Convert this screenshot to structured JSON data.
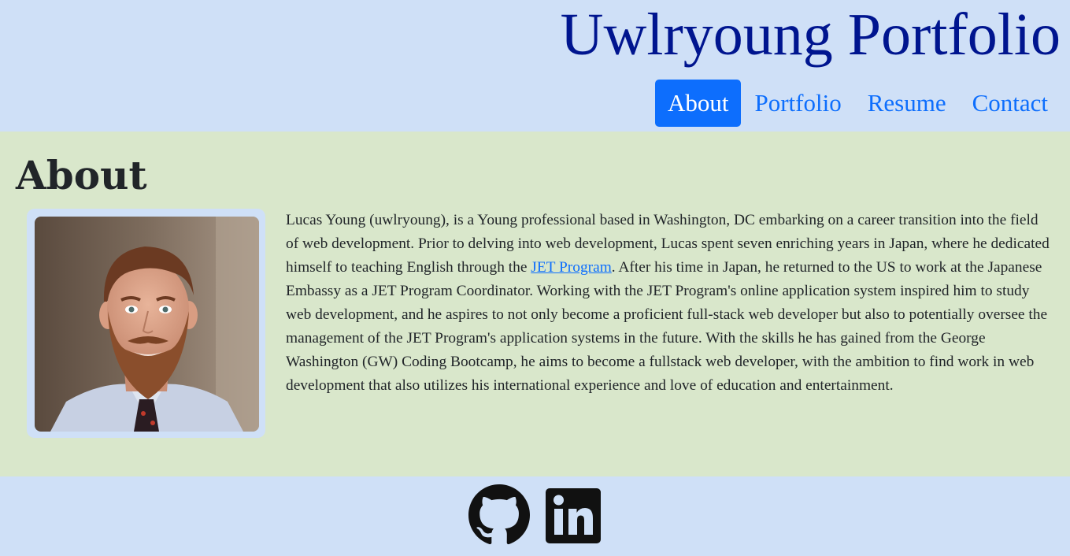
{
  "header": {
    "title": "Uwlryoung Portfolio",
    "nav": [
      {
        "label": "About",
        "active": true
      },
      {
        "label": "Portfolio",
        "active": false
      },
      {
        "label": "Resume",
        "active": false
      },
      {
        "label": "Contact",
        "active": false
      }
    ]
  },
  "about": {
    "heading": "About",
    "photo_icon": "profile-photo",
    "bio_part1": "Lucas Young (uwlryoung), is a Young professional based in Washington, DC embarking on a career transition into the field of web development. Prior to delving into web development, Lucas spent seven enriching years in Japan, where he dedicated himself to teaching English through the ",
    "bio_link": "JET Program",
    "bio_part2": ". After his time in Japan, he returned to the US to work at the Japanese Embassy as a JET Program Coordinator. Working with the JET Program's online application system inspired him to study web development, and he aspires to not only become a proficient full-stack web developer but also to potentially oversee the management of the JET Program's application systems in the future. With the skills he has gained from the George Washington (GW) Coding Bootcamp, he aims to become a fullstack web developer, with the ambition to find work in web development that also utilizes his international experience and love of education and entertainment."
  },
  "footer": {
    "social": [
      {
        "icon": "github-icon"
      },
      {
        "icon": "linkedin-icon"
      }
    ]
  },
  "colors": {
    "header_bg": "#cfe0f7",
    "about_bg": "#d9e7cb",
    "title": "#00158f",
    "accent": "#0d6efd"
  }
}
